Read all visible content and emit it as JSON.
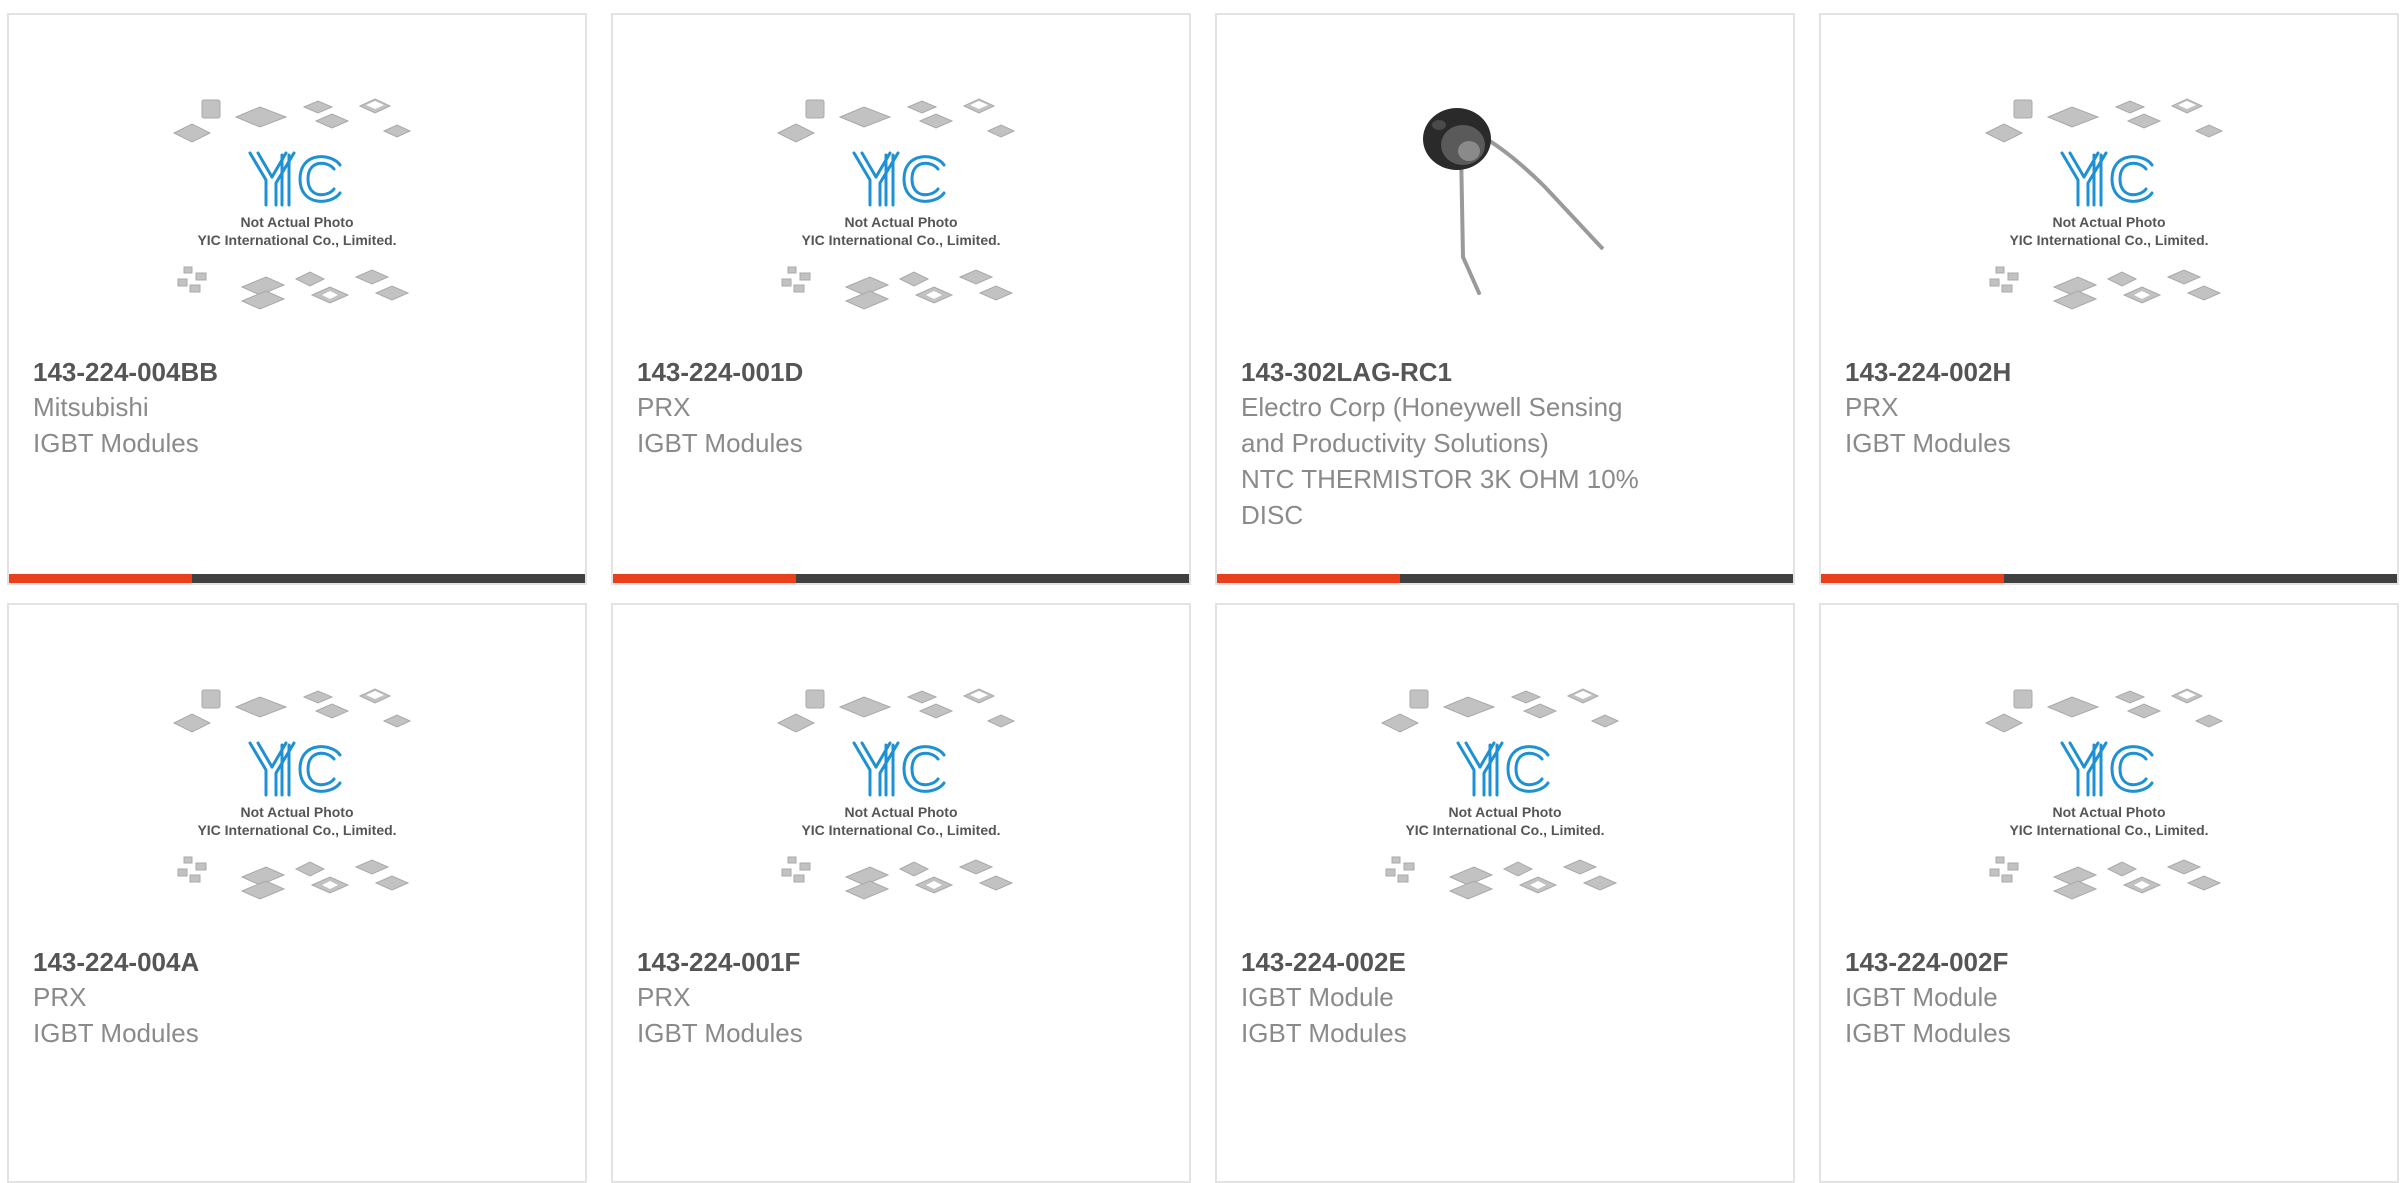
{
  "colors": {
    "accent_red": "#e8401c",
    "accent_dark": "#404040",
    "border": "#e3e3e3",
    "part_number": "#555555",
    "detail_text": "#8a8a8a",
    "logo_blue": "#1e90d4"
  },
  "placeholder": {
    "note": "Not Actual Photo",
    "company": "YIC International Co., Limited.",
    "logo": "YIC"
  },
  "products": [
    {
      "part_number": "143-224-004BB",
      "manufacturer": "Mitsubishi",
      "description": "IGBT Modules",
      "image": "placeholder-image"
    },
    {
      "part_number": "143-224-001D",
      "manufacturer": "PRX",
      "description": "IGBT Modules",
      "image": "placeholder-image"
    },
    {
      "part_number": "143-302LAG-RC1",
      "manufacturer": "Electro Corp (Honeywell Sensing and Productivity Solutions)",
      "description": "NTC THERMISTOR 3K OHM 10% DISC",
      "image": "thermistor-photo"
    },
    {
      "part_number": "143-224-002H",
      "manufacturer": "PRX",
      "description": "IGBT Modules",
      "image": "placeholder-image"
    },
    {
      "part_number": "143-224-004A",
      "manufacturer": "PRX",
      "description": "IGBT Modules",
      "image": "placeholder-image"
    },
    {
      "part_number": "143-224-001F",
      "manufacturer": "PRX",
      "description": "IGBT Modules",
      "image": "placeholder-image"
    },
    {
      "part_number": "143-224-002E",
      "manufacturer": "IGBT Module",
      "description": "IGBT Modules",
      "image": "placeholder-image"
    },
    {
      "part_number": "143-224-002F",
      "manufacturer": "IGBT Module",
      "description": "IGBT Modules",
      "image": "placeholder-image"
    }
  ]
}
